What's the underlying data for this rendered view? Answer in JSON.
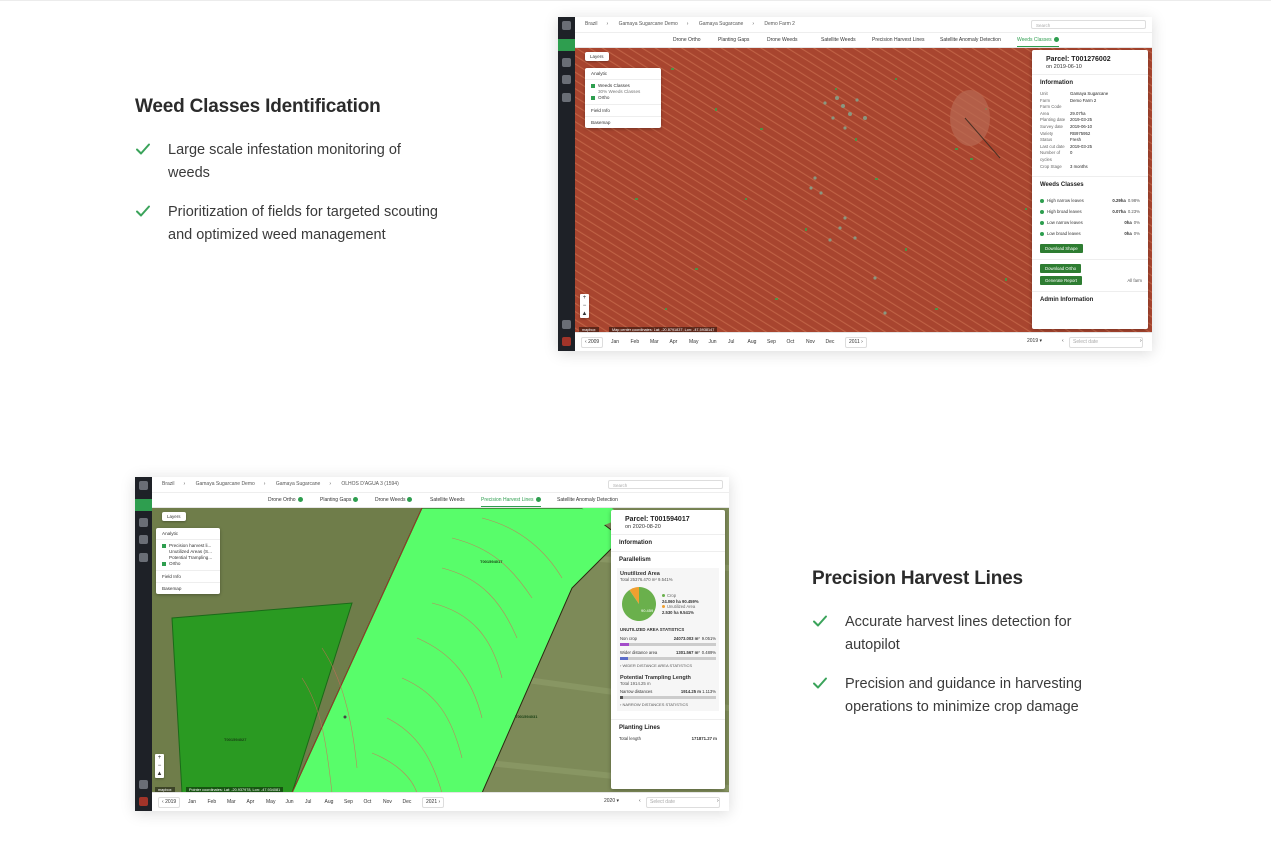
{
  "section1": {
    "title": "Weed Classes Identification",
    "bullets": [
      "Large scale infestation monitoring of weeds",
      "Prioritization of fields for targeted scouting and optimized weed management"
    ]
  },
  "section2": {
    "title": "Precision Harvest Lines",
    "bullets": [
      "Accurate harvest lines detection for autopilot",
      "Precision and guidance in harvesting operations to minimize crop damage"
    ]
  },
  "app1": {
    "breadcrumb": [
      "Brazil",
      "Gamaya Sugarcane Demo",
      "Gamaya Sugarcane",
      "Demo Farm 2"
    ],
    "search_placeholder": "Search",
    "tabs": [
      "Drone Ortho",
      "Planting Gaps",
      "Drone Weeds",
      "Satellite Weeds",
      "Precision Harvest Lines",
      "Satellite Anomaly Detection",
      "Weeds Classes"
    ],
    "active_tab": "Weeds Classes",
    "layers_label": "Layers",
    "layers": {
      "analytic": "Analytic",
      "weeds_classes": "Weeds Classes",
      "weeds_sub": "30% Weeds Classes",
      "ortho": "Ortho",
      "field_info": "Field Info",
      "basemap": "Basemap"
    },
    "parcel_title": "Parcel: T001276002",
    "parcel_date": "on 2019-06-10",
    "info_label": "Information",
    "info": [
      {
        "k": "Unit",
        "v": "Gamaya Sugarcane"
      },
      {
        "k": "Farm",
        "v": "Demo Farm 2"
      },
      {
        "k": "Farm Code",
        "v": ""
      },
      {
        "k": "Area",
        "v": "29.07ha"
      },
      {
        "k": "Planting date",
        "v": "2019-03-25"
      },
      {
        "k": "Survey date",
        "v": "2019-06-10"
      },
      {
        "k": "Variety",
        "v": "RB975952"
      },
      {
        "k": "Status",
        "v": "Fresh"
      },
      {
        "k": "Last cut date",
        "v": "2019-03-25"
      },
      {
        "k": "Number of cycles",
        "v": "0"
      },
      {
        "k": "Crop Stage",
        "v": "3 months"
      }
    ],
    "weeds_label": "Weeds Classes",
    "weeds": [
      {
        "name": "High narrow leaves",
        "area": "0.29ha",
        "pct": "0.98%"
      },
      {
        "name": "High broad leaves",
        "area": "0.07ha",
        "pct": "0.23%"
      },
      {
        "name": "Low narrow leaves",
        "area": "0ha",
        "pct": "0%"
      },
      {
        "name": "Low broad leaves",
        "area": "0ha",
        "pct": "0%"
      }
    ],
    "download_shape": "Download Shape",
    "download_ortho": "Download Ortho",
    "generate_report": "Generate Report",
    "all_farm": "All farm",
    "admin_label": "Admin Information",
    "months": [
      "Jan",
      "Feb",
      "Mar",
      "Apr",
      "May",
      "Jun",
      "Jul",
      "Aug",
      "Sep",
      "Oct",
      "Nov",
      "Dec"
    ],
    "prev_year": "2009",
    "next_year": "2011",
    "year_select": "2019",
    "date_placeholder": "Select date",
    "map_coords": "Map center coordinates: Lat: -20.8791837, Lon: -47.5938147",
    "mapbox": "mapbox"
  },
  "app2": {
    "breadcrumb": [
      "Brazil",
      "Gamaya Sugarcane Demo",
      "Gamaya Sugarcane",
      "OLHOS D'AGUA 3 (1594)"
    ],
    "search_placeholder": "Search",
    "tabs": [
      "Drone Ortho",
      "Planting Gaps",
      "Drone Weeds",
      "Satellite Weeds",
      "Precision Harvest Lines",
      "Satellite Anomaly Detection"
    ],
    "active_tab": "Precision Harvest Lines",
    "layers_label": "Layers",
    "layers": {
      "analytic": "Analytic",
      "l1": "Precision harvest li...",
      "l2": "Unutilized Areas (S...",
      "l3": "Potential Trampling...",
      "ortho": "Ortho",
      "field_info": "Field Info",
      "basemap": "Basemap"
    },
    "parcel_title": "Parcel: T001594017",
    "parcel_date": "on 2020-08-20",
    "info_label": "Information",
    "parallelism_label": "Parallelism",
    "unutilized_title": "Unutilized Area",
    "unutilized_total": "Total 25376.470 m² 9.541%",
    "legend": [
      {
        "name": "Crop",
        "value": "24.060 ha 90.459%",
        "color": "#6ab04c"
      },
      {
        "name": "Unutilized Area",
        "value": "2.530 ha 9.541%",
        "color": "#f0a030"
      }
    ],
    "pie": {
      "crop": 90.459,
      "unutilized": 9.541,
      "label": "90.459"
    },
    "stats_title": "UNUTILIZED AREA STATISTICS",
    "stats": [
      {
        "name": "Non crop",
        "value": "24073.003 m²",
        "pct": "9.051%",
        "fill": 0.09,
        "color": "#a34cc9"
      },
      {
        "name": "Wider distance area",
        "value": "1301.567 m²",
        "pct": "0.489%",
        "fill": 0.01,
        "color": "#5b6cc9"
      }
    ],
    "stats_link": "WIDER DISTANCE AREA STATISTICS",
    "trampling_title": "Potential Trampling Length",
    "trampling_total": "Total 1914.25 m",
    "narrow": {
      "name": "Narrow distances",
      "value": "1914.25 m",
      "pct": "1.113%",
      "fill": 0.02
    },
    "narrow_link": "NARROW DISTANCES STATISTICS",
    "planting_lines_label": "Planting Lines",
    "total_length_label": "Total length",
    "total_length_value": "171871.27 m",
    "field_labels": [
      "T001594017",
      "T001594027",
      "T001594031"
    ],
    "months": [
      "Jan",
      "Feb",
      "Mar",
      "Apr",
      "May",
      "Jun",
      "Jul",
      "Aug",
      "Sep",
      "Oct",
      "Nov",
      "Dec"
    ],
    "prev_year": "2019",
    "next_year": "2021",
    "year_select": "2020",
    "date_placeholder": "Select date",
    "map_coords": "Pointer coordinates: Lat: -20.937978, Lon: -47.934081",
    "mapbox": "mapbox"
  }
}
